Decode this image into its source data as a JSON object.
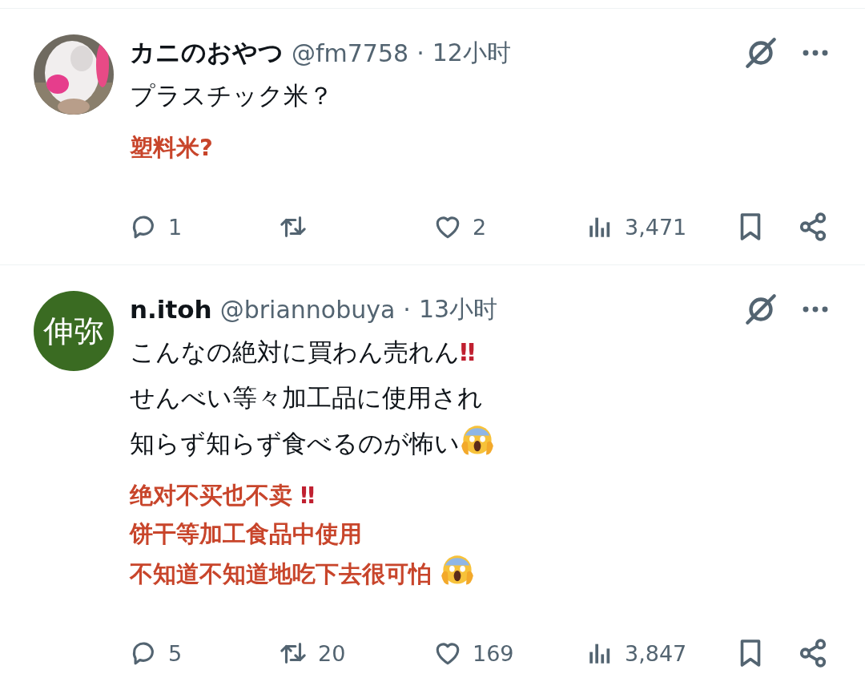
{
  "posts": [
    {
      "avatar": {
        "kind": "picture"
      },
      "name": "カニのおやつ",
      "handle": "@fm7758",
      "separator": "·",
      "time": "12小时",
      "lines": [
        {
          "text": "プラスチック米？"
        }
      ],
      "translation": [
        {
          "text": "塑料米?"
        }
      ],
      "stats": {
        "replies": "1",
        "likes": "2",
        "views": "3,471"
      }
    },
    {
      "avatar": {
        "kind": "initials",
        "text": "伸弥",
        "color": "#3a6b22"
      },
      "name": "n.itoh",
      "handle": "@briannobuya",
      "separator": "·",
      "time": "13小时",
      "lines": [
        {
          "text": "こんなの絶対に買わん売れん",
          "mark": "‼"
        },
        {
          "text": "せんべい等々加工品に使用され"
        },
        {
          "text": "知らず知らず食べるのが怖い",
          "emoji": true
        }
      ],
      "translation": [
        {
          "text": "绝对不买也不卖 ",
          "mark": "‼"
        },
        {
          "text": "饼干等加工食品中使用"
        },
        {
          "text": "不知道不知道地吃下去很可怕 ",
          "emoji": true
        }
      ],
      "stats": {
        "replies": "5",
        "reposts": "20",
        "likes": "169",
        "views": "3,847"
      }
    }
  ]
}
